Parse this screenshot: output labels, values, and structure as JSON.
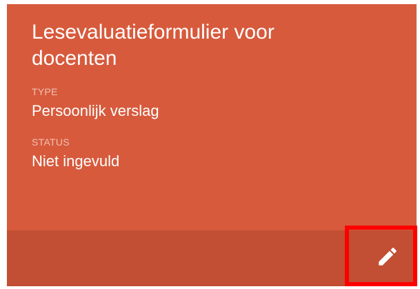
{
  "card": {
    "title": "Lesevaluatieformulier voor docenten",
    "type_label": "TYPE",
    "type_value": "Persoonlijk verslag",
    "status_label": "STATUS",
    "status_value": "Niet ingevuld",
    "edit_icon": "pencil-icon"
  },
  "colors": {
    "card_background": "#d75a3c",
    "footer_background": "#c24e33",
    "highlight": "#ff0000"
  }
}
